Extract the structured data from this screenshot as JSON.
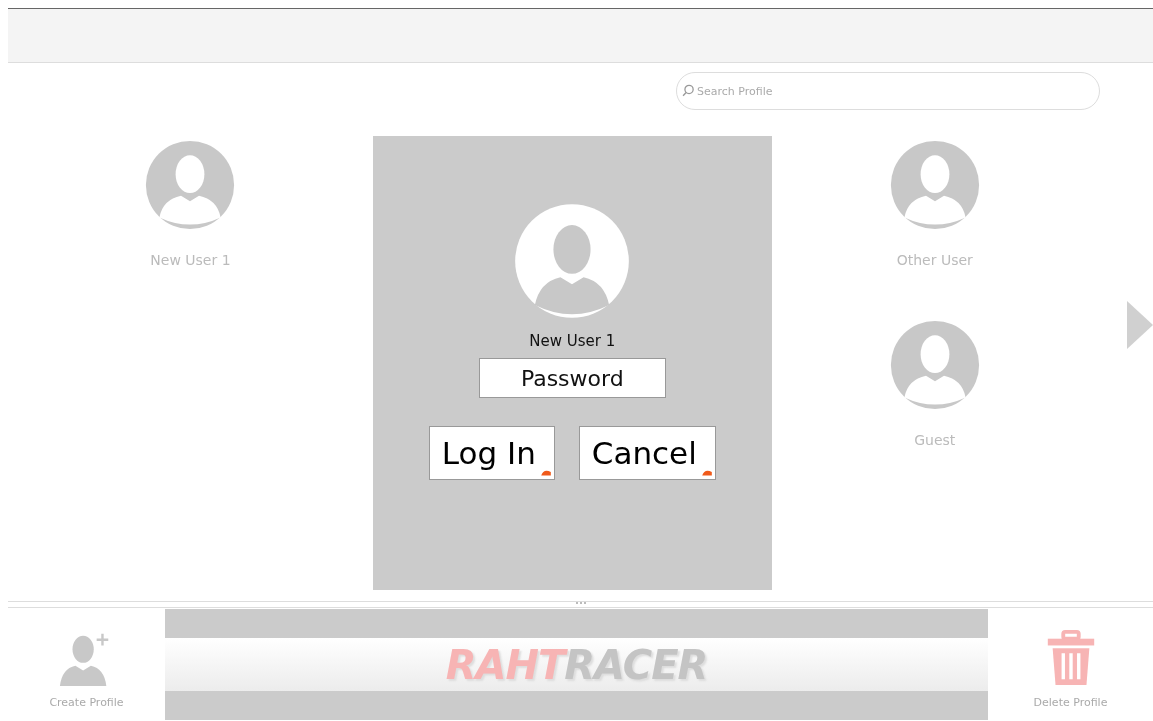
{
  "search": {
    "placeholder": "Search Profile"
  },
  "left_profiles": [
    {
      "name": "New User 1"
    }
  ],
  "login_dialog": {
    "user_name": "New User 1",
    "password_placeholder": "Password",
    "buttons": [
      "Log In",
      "Cancel"
    ]
  },
  "right_profiles": [
    {
      "name": "Other User"
    },
    {
      "name": "Guest"
    }
  ],
  "bottom_bar": {
    "create_label": "Create Profile",
    "logo": [
      {
        "text": "RAHT",
        "color": "#f7b4b4"
      },
      {
        "text": "RACER",
        "color": "#c4c4c4"
      }
    ],
    "delete_label": "Delete Profile"
  }
}
